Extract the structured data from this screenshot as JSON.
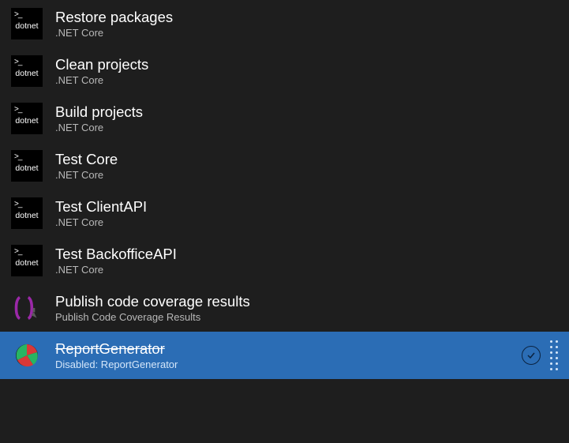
{
  "tasks": [
    {
      "title": "Restore packages",
      "subtitle": ".NET Core",
      "icon": "dotnet",
      "selected": false
    },
    {
      "title": "Clean projects",
      "subtitle": ".NET Core",
      "icon": "dotnet",
      "selected": false
    },
    {
      "title": "Build projects",
      "subtitle": ".NET Core",
      "icon": "dotnet",
      "selected": false
    },
    {
      "title": "Test Core",
      "subtitle": ".NET Core",
      "icon": "dotnet",
      "selected": false
    },
    {
      "title": "Test ClientAPI",
      "subtitle": ".NET Core",
      "icon": "dotnet",
      "selected": false
    },
    {
      "title": "Test BackofficeAPI",
      "subtitle": ".NET Core",
      "icon": "dotnet",
      "selected": false
    },
    {
      "title": "Publish code coverage results",
      "subtitle": "Publish Code Coverage Results",
      "icon": "coverage",
      "selected": false
    },
    {
      "title": "ReportGenerator",
      "subtitle": "Disabled: ReportGenerator",
      "icon": "report",
      "selected": true
    }
  ],
  "iconLabels": {
    "dotnet": "dotnet"
  }
}
